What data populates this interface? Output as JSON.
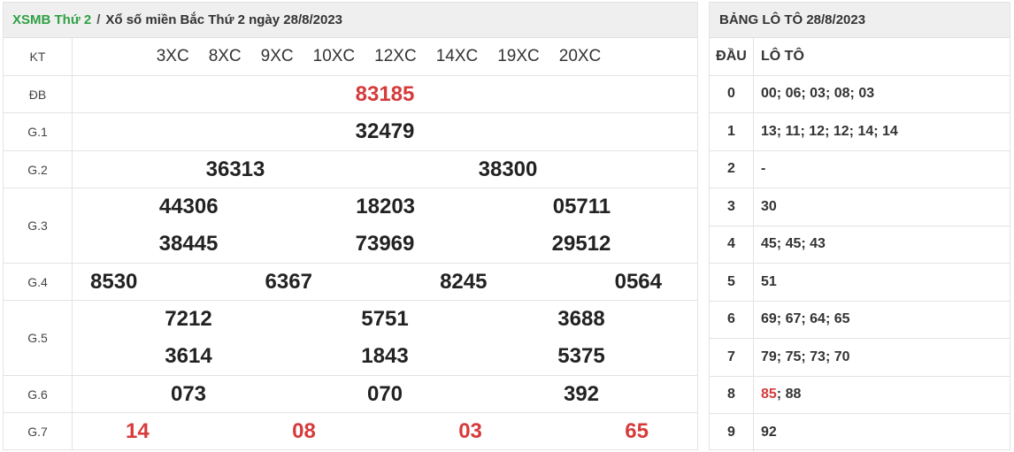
{
  "breadcrumb": {
    "link": "XSMB Thứ 2",
    "separator": "/",
    "current": "Xổ số miền Bắc Thứ 2 ngày 28/8/2023"
  },
  "results": {
    "kt_label": "KT",
    "codes": [
      "3XC",
      "8XC",
      "9XC",
      "10XC",
      "12XC",
      "14XC",
      "19XC",
      "20XC"
    ],
    "prizes": [
      {
        "label": "ĐB",
        "lines": [
          [
            "83185"
          ]
        ],
        "red": true
      },
      {
        "label": "G.1",
        "lines": [
          [
            "32479"
          ]
        ]
      },
      {
        "label": "G.2",
        "lines": [
          [
            "36313",
            "38300"
          ]
        ]
      },
      {
        "label": "G.3",
        "lines": [
          [
            "44306",
            "18203",
            "05711"
          ],
          [
            "38445",
            "73969",
            "29512"
          ]
        ]
      },
      {
        "label": "G.4",
        "lines": [
          [
            "8530",
            "6367",
            "8245",
            "0564"
          ]
        ]
      },
      {
        "label": "G.5",
        "lines": [
          [
            "7212",
            "5751",
            "3688"
          ],
          [
            "3614",
            "1843",
            "5375"
          ]
        ]
      },
      {
        "label": "G.6",
        "lines": [
          [
            "073",
            "070",
            "392"
          ]
        ]
      },
      {
        "label": "G.7",
        "lines": [
          [
            "14",
            "08",
            "03",
            "65"
          ]
        ],
        "red": true
      }
    ]
  },
  "loto": {
    "title": "BẢNG LÔ TÔ 28/8/2023",
    "head_col": "ĐẦU",
    "val_col": "LÔ TÔ",
    "rows": [
      {
        "dau": "0",
        "values": [
          "00",
          "06",
          "03",
          "08",
          "03"
        ]
      },
      {
        "dau": "1",
        "values": [
          "13",
          "11",
          "12",
          "12",
          "14",
          "14"
        ]
      },
      {
        "dau": "2",
        "values": [
          "-"
        ]
      },
      {
        "dau": "3",
        "values": [
          "30"
        ]
      },
      {
        "dau": "4",
        "values": [
          "45",
          "45",
          "43"
        ]
      },
      {
        "dau": "5",
        "values": [
          "51"
        ]
      },
      {
        "dau": "6",
        "values": [
          "69",
          "67",
          "64",
          "65"
        ]
      },
      {
        "dau": "7",
        "values": [
          "79",
          "75",
          "73",
          "70"
        ]
      },
      {
        "dau": "8",
        "values": [
          "85",
          "88"
        ],
        "highlight_index": 0
      },
      {
        "dau": "9",
        "values": [
          "92"
        ]
      }
    ]
  },
  "colors": {
    "breadcrumb_link": "#2fa045",
    "highlight_red": "#d63b3b",
    "header_bg": "#efefef"
  }
}
